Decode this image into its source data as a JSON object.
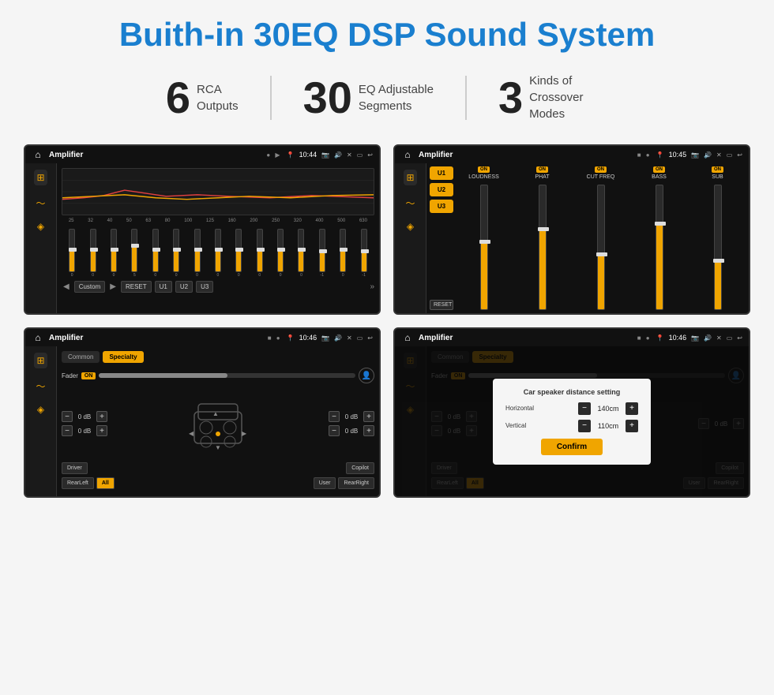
{
  "title": "Buith-in 30EQ DSP Sound System",
  "stats": [
    {
      "number": "6",
      "label": "RCA\nOutputs"
    },
    {
      "number": "30",
      "label": "EQ Adjustable\nSegments"
    },
    {
      "number": "3",
      "label": "Kinds of\nCrossover Modes"
    }
  ],
  "screens": [
    {
      "id": "eq-screen",
      "statusBar": {
        "title": "Amplifier",
        "time": "10:44"
      },
      "type": "eq"
    },
    {
      "id": "crossover-screen",
      "statusBar": {
        "title": "Amplifier",
        "time": "10:45"
      },
      "type": "crossover"
    },
    {
      "id": "speaker-screen",
      "statusBar": {
        "title": "Amplifier",
        "time": "10:46"
      },
      "type": "speaker"
    },
    {
      "id": "dialog-screen",
      "statusBar": {
        "title": "Amplifier",
        "time": "10:46"
      },
      "type": "dialog"
    }
  ],
  "eq": {
    "frequencies": [
      "25",
      "32",
      "40",
      "50",
      "63",
      "80",
      "100",
      "125",
      "160",
      "200",
      "250",
      "320",
      "400",
      "500",
      "630"
    ],
    "values": [
      0,
      0,
      0,
      5,
      0,
      0,
      0,
      0,
      0,
      0,
      0,
      0,
      "-1",
      0,
      "-1"
    ],
    "presets": [
      "Custom",
      "RESET",
      "U1",
      "U2",
      "U3"
    ]
  },
  "crossover": {
    "units": [
      "U1",
      "U2",
      "U3"
    ],
    "channels": [
      {
        "name": "LOUDNESS",
        "on": true
      },
      {
        "name": "PHAT",
        "on": true
      },
      {
        "name": "CUT FREQ",
        "on": true
      },
      {
        "name": "BASS",
        "on": true
      },
      {
        "name": "SUB",
        "on": true
      }
    ]
  },
  "speaker": {
    "tabs": [
      "Common",
      "Specialty"
    ],
    "activeTab": "Specialty",
    "fader": {
      "label": "Fader",
      "on": true
    },
    "zones": [
      {
        "label": "0 dB"
      },
      {
        "label": "0 dB"
      },
      {
        "label": "0 dB"
      },
      {
        "label": "0 dB"
      }
    ],
    "buttons": [
      {
        "label": "Driver"
      },
      {
        "label": "Copilot"
      },
      {
        "label": "RearLeft"
      },
      {
        "label": "All",
        "active": true
      },
      {
        "label": "User"
      },
      {
        "label": "RearRight"
      }
    ]
  },
  "dialog": {
    "title": "Car speaker distance setting",
    "horizontal": {
      "label": "Horizontal",
      "value": "140cm"
    },
    "vertical": {
      "label": "Vertical",
      "value": "110cm"
    },
    "confirmLabel": "Confirm",
    "tabs": [
      "Common",
      "Specialty"
    ],
    "activeTab": "Specialty"
  }
}
